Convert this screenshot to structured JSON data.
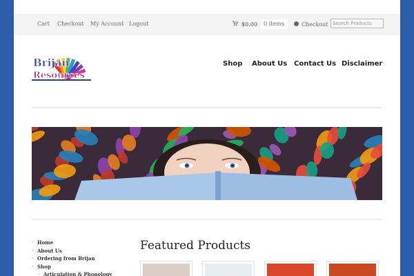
{
  "topbar": {
    "links": [
      "Cart",
      "Checkout",
      "My Account",
      "Logout"
    ],
    "cart_total": "$0.00",
    "cart_items": "0 items",
    "checkout_label": "Checkout",
    "search_placeholder": "Search Products"
  },
  "logo": {
    "alt": "Brijan Resources"
  },
  "nav": [
    "Shop",
    "About Us",
    "Contact Us",
    "Disclaimer"
  ],
  "sidebar": [
    {
      "label": "Home",
      "sub": false
    },
    {
      "label": "About Us",
      "sub": false
    },
    {
      "label": "Ordering from Brijan",
      "sub": false
    },
    {
      "label": "Shop",
      "sub": false
    },
    {
      "label": "Articulation & Phonology",
      "sub": true
    }
  ],
  "featured": {
    "title": "Featured Products",
    "products": [
      {
        "name": "product-1",
        "color": "#d9cfc4"
      },
      {
        "name": "product-2",
        "color": "#e8eef0"
      },
      {
        "name": "product-3",
        "color": "#d8472a"
      },
      {
        "name": "product-4",
        "color": "#c94a22"
      }
    ]
  },
  "colors": {
    "background": "#2b5ea6",
    "page": "#ffffff",
    "topbar": "#f3f3f3"
  }
}
